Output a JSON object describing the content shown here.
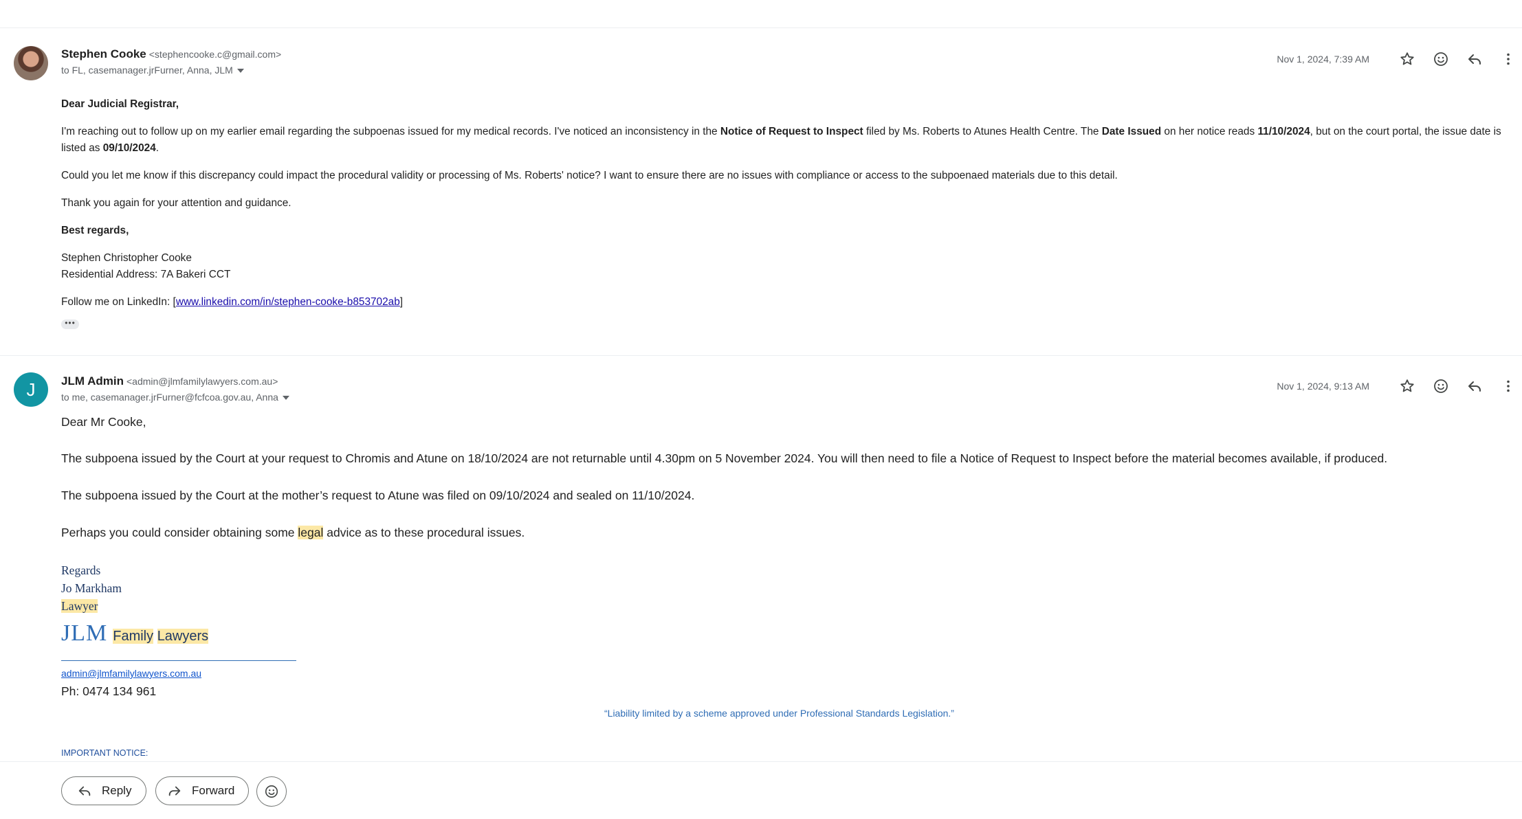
{
  "messages": [
    {
      "sender_name": "Stephen Cooke",
      "sender_email": "<stephencooke.c@gmail.com>",
      "recipients": "to FL, casemanager.jrFurner, Anna, JLM",
      "date": "Nov 1, 2024, 7:39 AM",
      "body": {
        "greeting": "Dear Judicial Registrar,",
        "p1": {
          "a": "I'm reaching out to follow up on my earlier email regarding the subpoenas issued for my medical records. I've noticed an inconsistency in the ",
          "b": "Notice of Request to Inspect",
          "c": " filed by Ms. Roberts to Atunes Health Centre. The ",
          "d": "Date Issued",
          "e": " on her notice reads ",
          "f": "11/10/2024",
          "g": ", but on the court portal, the issue date is listed as ",
          "h": "09/10/2024",
          "i": "."
        },
        "p2": "Could you let me know if this discrepancy could impact the procedural validity or processing of Ms. Roberts' notice? I want to ensure there are no issues with compliance or access to the subpoenaed materials due to this detail.",
        "p3": "Thank you again for your attention and guidance.",
        "closing": "Best regards,",
        "name": "Stephen Christopher Cooke",
        "address": "Residential Address: 7A Bakeri CCT",
        "follow_prefix": "Follow me on LinkedIn: [",
        "follow_link": "www.linkedin.com/in/stephen-cooke-b853702ab",
        "follow_suffix": "]",
        "trimmed": "•••"
      }
    },
    {
      "avatar_letter": "J",
      "sender_name": "JLM Admin",
      "sender_email": "<admin@jlmfamilylawyers.com.au>",
      "recipients": "to me, casemanager.jrFurner@fcfcoa.gov.au, Anna",
      "date": "Nov 1, 2024, 9:13 AM",
      "body": {
        "greeting": "Dear Mr Cooke,",
        "p1": "The subpoena issued by the Court at your request to Chromis and Atune on 18/10/2024 are not returnable until 4.30pm on 5 November 2024.  You will then need to file a Notice of Request to Inspect before the material becomes available, if produced.",
        "p2": "The subpoena issued by the Court at the mother’s request to Atune was filed on 09/10/2024 and sealed on 11/10/2024.",
        "p3_a": "Perhaps you could consider obtaining some ",
        "p3_b": "legal",
        "p3_c": " advice as to these procedural issues.",
        "regards": "Regards",
        "signer": "Jo Markham",
        "title": "Lawyer",
        "logo_main": "JLM",
        "logo_family": "Family",
        "logo_lawyers": "Lawyers",
        "email": "admin@jlmfamilylawyers.com.au",
        "phone": "Ph: 0474 134 961",
        "liability": "“Liability limited by a scheme approved under Professional Standards Legislation.”",
        "notice": "IMPORTANT NOTICE:"
      }
    }
  ],
  "actions": {
    "reply": "Reply",
    "forward": "Forward"
  },
  "icons": [
    "star-icon",
    "emoji-icon",
    "reply-icon",
    "more-icon",
    "forward-icon",
    "dropdown-caret-icon"
  ]
}
